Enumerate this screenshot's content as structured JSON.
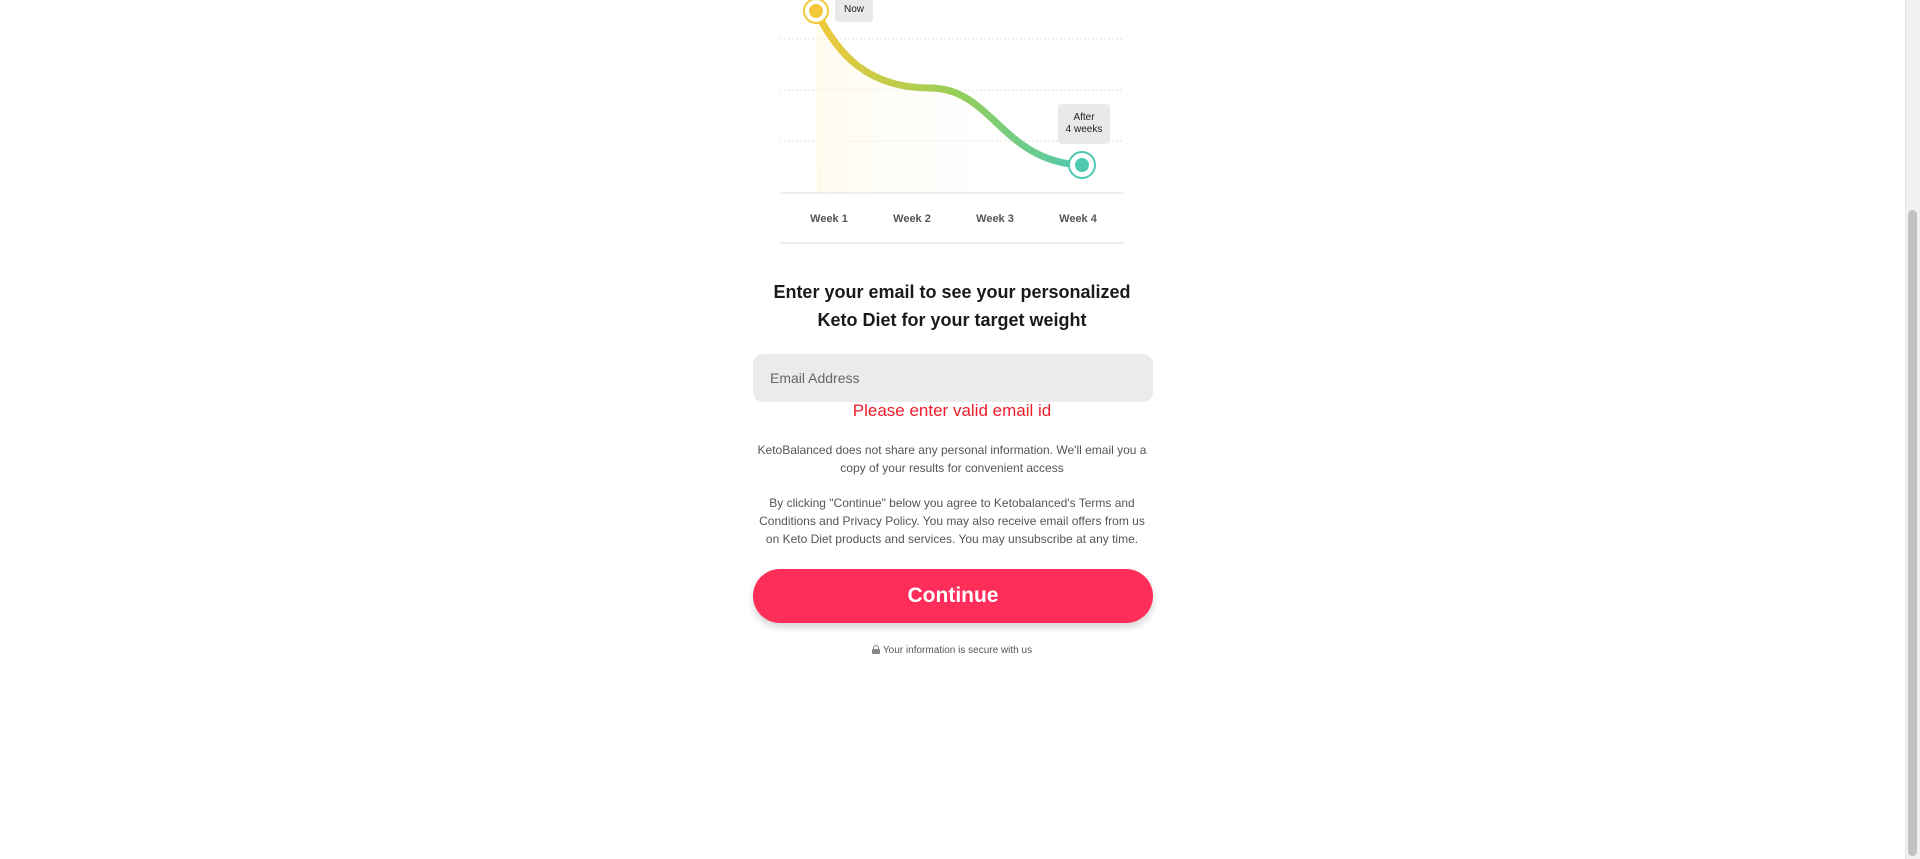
{
  "chart": {
    "now_label": "Now",
    "after_label_line1": "After",
    "after_label_line2": "4 weeks",
    "weeks": [
      "Week 1",
      "Week 2",
      "Week 3",
      "Week 4"
    ],
    "colors": {
      "start": "#f1c83a",
      "end": "#4ec9b0"
    }
  },
  "chart_data": {
    "type": "line",
    "categories": [
      "Week 1",
      "Week 2",
      "Week 3",
      "Week 4"
    ],
    "annotations": [
      "Now",
      "After 4 weeks"
    ],
    "grid": true
  },
  "form": {
    "headline": "Enter your email to see your personalized Keto Diet for your target weight",
    "email_placeholder": "Email Address",
    "error": "Please enter valid email id",
    "privacy": "KetoBalanced does not share any personal information. We'll email you a copy of your results for convenient access",
    "terms": "By clicking \"Continue\" below you agree to Ketobalanced's Terms and Conditions and Privacy Policy. You may also receive email offers from us on Keto Diet products and services. You may unsubscribe at any time.",
    "continue_label": "Continue",
    "secure_text": "Your information is secure with us"
  },
  "colors": {
    "accent": "#ff2d5a",
    "error": "#ee1d2a"
  }
}
